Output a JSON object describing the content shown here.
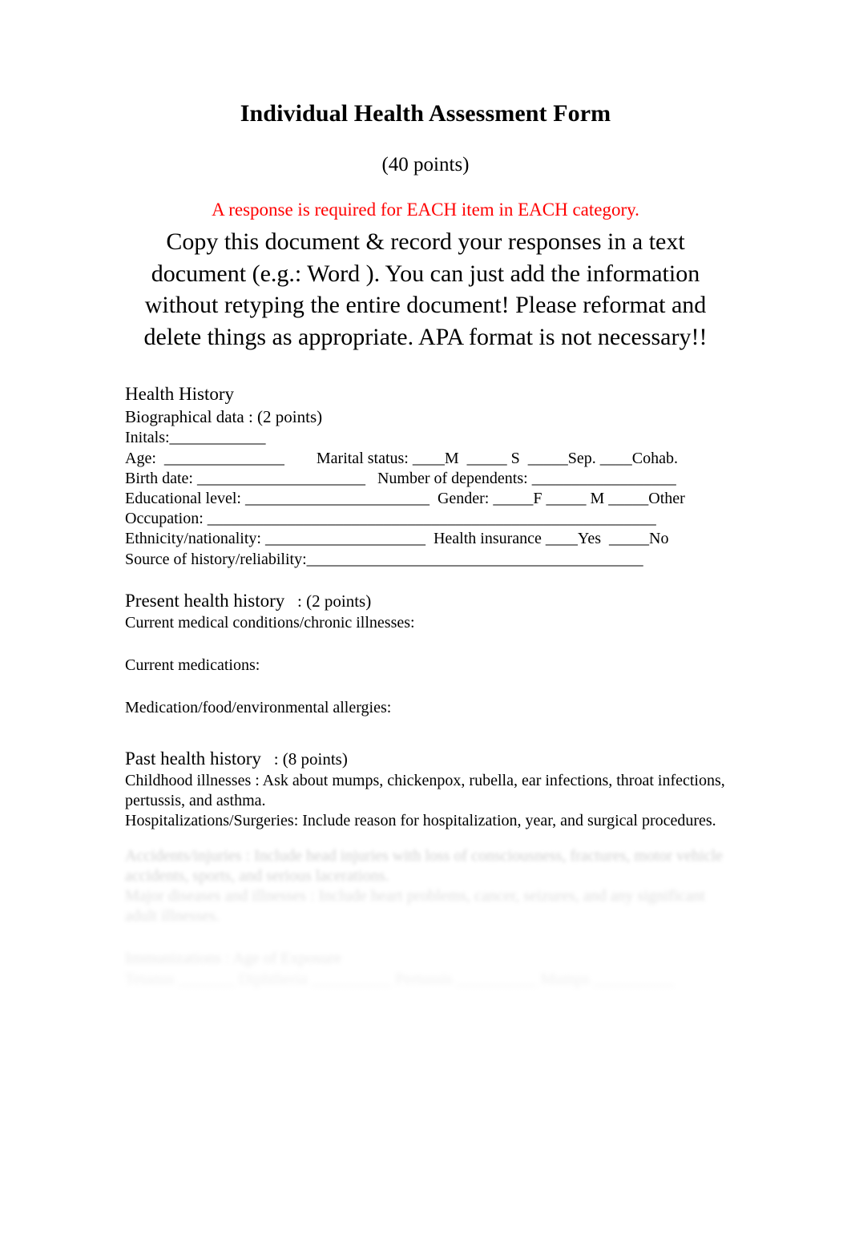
{
  "document": {
    "title": "Individual Health Assessment Form",
    "subtitle": "(40 points)",
    "warning": "A response is required for EACH item in EACH category.",
    "warning_color": "#FF0000",
    "instructions": "Copy this document & record your responses in a text document (e.g.: Word ). You can just add the information without retyping the entire document! Please reformat and delete things as appropriate. APA format is not necessary!!"
  },
  "health_history": {
    "heading": "Health History",
    "biographical": {
      "label": "Biographical data  : (2 points)",
      "fields": {
        "initials": "Initals:____________",
        "age_marital": "Age:  _______________        Marital status: ____M  _____ S  _____Sep. ____Cohab.",
        "birth_dependents": "Birth date: _____________________   Number of dependents: __________________",
        "education_gender": "Educational level: _______________________  Gender: _____F _____ M _____Other",
        "occupation": "Occupation: ________________________________________________________",
        "ethnicity_insurance": "Ethnicity/nationality: ____________________  Health insurance ____Yes  _____No",
        "source": "Source of history/reliability:__________________________________________"
      }
    },
    "present": {
      "heading": "Present health history",
      "points": ": (2 points)",
      "items": [
        "Current medical conditions/chronic illnesses:",
        "Current medications:",
        "Medication/food/environmental allergies:"
      ]
    },
    "past": {
      "heading": "Past health history",
      "points": ": (8 points)",
      "items": [
        "Childhood illnesses : Ask about mumps, chickenpox, rubella, ear infections, throat infections, pertussis, and asthma.",
        "Hospitalizations/Surgeries:    Include reason for hospitalization, year, and surgical procedures."
      ],
      "faded_items": [
        "Accidents/injuries :  Include head injuries with loss of consciousness, fractures, motor vehicle accidents, sports, and serious lacerations.",
        "Major diseases and illnesses :  Include heart problems, cancer, seizures, and any significant adult illnesses.",
        "Immunizations :  Age of Exposure",
        "Tetanus _______  Diphtheria __________  Pertussis __________  Mumps __________"
      ]
    }
  }
}
